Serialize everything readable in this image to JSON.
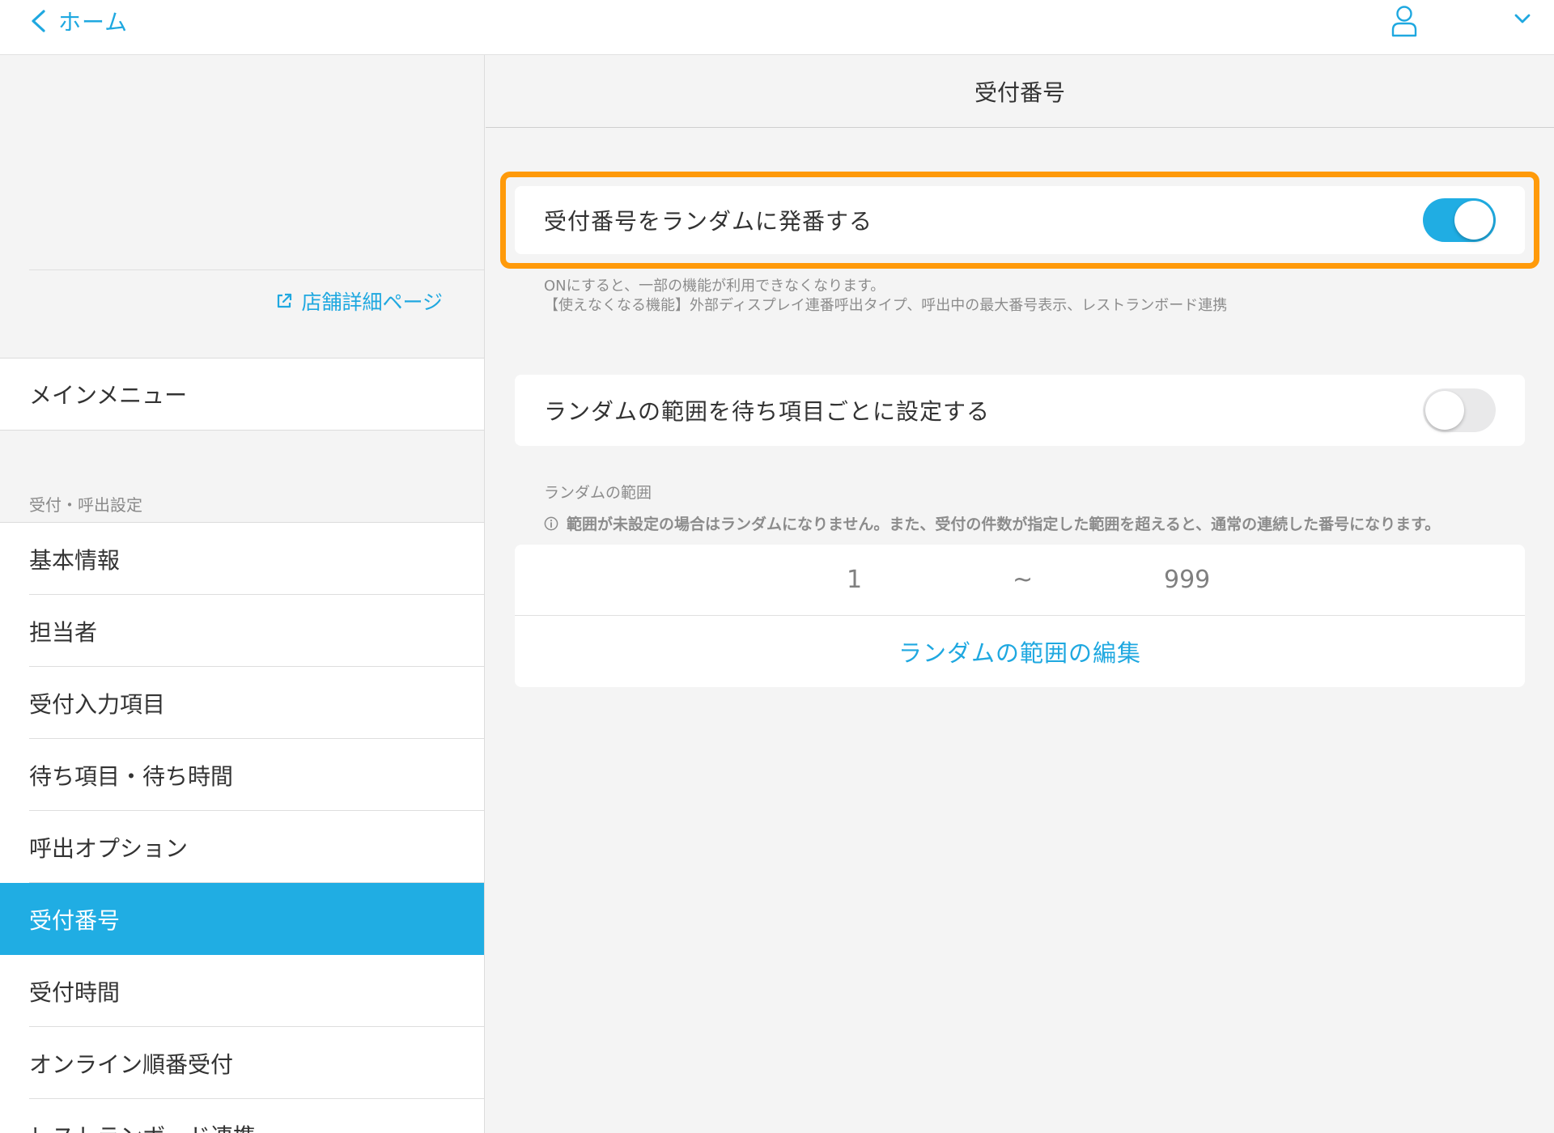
{
  "colors": {
    "accent": "#20ade3",
    "highlight": "#ff9a0a",
    "text": "#333333",
    "muted": "#8c8c8c"
  },
  "topbar": {
    "back_label": "ホーム",
    "back_icon": "chevron-left-icon",
    "user_icon": "user-icon",
    "dropdown_icon": "chevron-down-icon"
  },
  "sidebar": {
    "store_link": "店舗詳細ページ",
    "main_menu": "メインメニュー",
    "section_label": "受付・呼出設定",
    "items": [
      {
        "label": "基本情報"
      },
      {
        "label": "担当者"
      },
      {
        "label": "受付入力項目"
      },
      {
        "label": "待ち項目・待ち時間"
      },
      {
        "label": "呼出オプション"
      },
      {
        "label": "受付番号",
        "active": true
      },
      {
        "label": "受付時間"
      },
      {
        "label": "オンライン順番受付"
      },
      {
        "label": "レストランボード連携"
      }
    ]
  },
  "content": {
    "title": "受付番号",
    "random_issue": {
      "label": "受付番号をランダムに発番する",
      "enabled": true
    },
    "note_line1": "ONにすると、一部の機能が利用できなくなります。",
    "note_line2": "【使えなくなる機能】外部ディスプレイ連番呼出タイプ、呼出中の最大番号表示、レストランボード連携",
    "range_per_item": {
      "label": "ランダムの範囲を待ち項目ごとに設定する",
      "enabled": false
    },
    "range_title": "ランダムの範囲",
    "range_info": "範囲が未設定の場合はランダムになりません。また、受付の件数が指定した範囲を超えると、通常の連続した番号になります。",
    "range": {
      "min": "1",
      "separator": "~",
      "max": "999"
    },
    "range_edit": "ランダムの範囲の編集"
  }
}
